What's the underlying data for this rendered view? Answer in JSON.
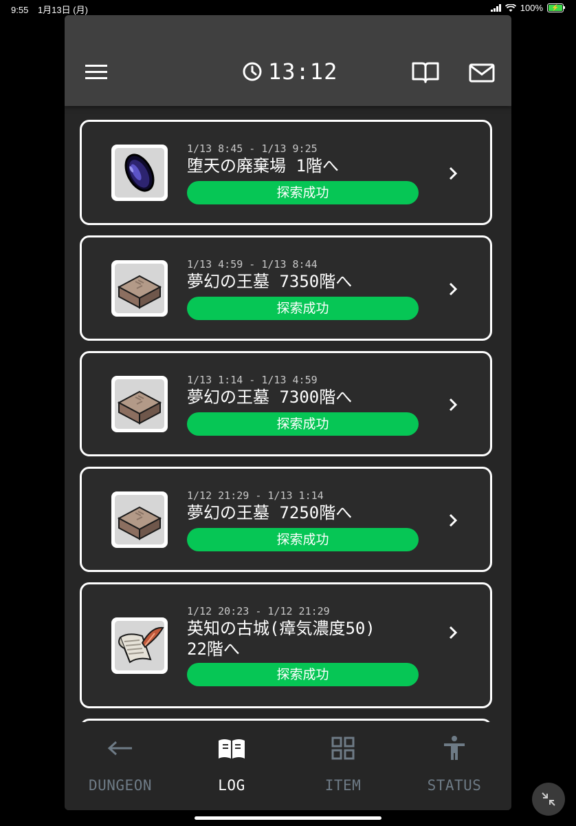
{
  "system_status": {
    "time": "9:55",
    "date": "1月13日 (月)",
    "battery": "100%"
  },
  "header": {
    "clock_time": "13:12"
  },
  "log_entries": [
    {
      "period": "1/13 8:45 - 1/13 9:25",
      "title": "堕天の廃棄場 1階へ",
      "status": "探索成功",
      "icon": "dark-crystal-icon"
    },
    {
      "period": "1/13 4:59 - 1/13 8:44",
      "title": "夢幻の王墓 7350階へ",
      "status": "探索成功",
      "icon": "stone-tablet-icon"
    },
    {
      "period": "1/13 1:14 - 1/13 4:59",
      "title": "夢幻の王墓 7300階へ",
      "status": "探索成功",
      "icon": "stone-tablet-icon"
    },
    {
      "period": "1/12 21:29 - 1/13 1:14",
      "title": "夢幻の王墓 7250階へ",
      "status": "探索成功",
      "icon": "stone-tablet-icon"
    },
    {
      "period": "1/12 20:23 - 1/12 21:29",
      "title_line1": "英知の古城(瘴気濃度50)",
      "title_line2": "22階へ",
      "status": "探索成功",
      "icon": "scroll-quill-icon"
    }
  ],
  "tabs": [
    {
      "label": "DUNGEON",
      "icon": "arrow-left-icon"
    },
    {
      "label": "LOG",
      "icon": "open-book-icon"
    },
    {
      "label": "ITEM",
      "icon": "grid-icon"
    },
    {
      "label": "STATUS",
      "icon": "person-icon"
    }
  ],
  "colors": {
    "status_success": "#06c655",
    "header_bg": "#404040",
    "card_bg": "#2b2b2b",
    "tab_inactive": "#6e7b86"
  }
}
